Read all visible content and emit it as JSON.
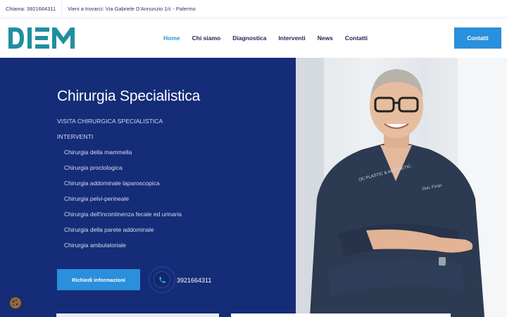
{
  "topbar": {
    "phone": "Chiama: 3921664311",
    "address": "Vieni a trovarci: Via Gabriele D'Annunzio 1/c - Palermo"
  },
  "brand": {
    "logo_text": "DIEM",
    "logo_color": "#1f8fa0"
  },
  "nav": {
    "items": [
      {
        "label": "Home",
        "active": true
      },
      {
        "label": "Chi siamo"
      },
      {
        "label": "Diagnostica"
      },
      {
        "label": "Interventi"
      },
      {
        "label": "News"
      },
      {
        "label": "Contatti"
      }
    ],
    "cta_label": "Contatti"
  },
  "hero": {
    "title": "Chirurgia Specialistica",
    "visit_label": "VISITA CHIRURGICA SPECIALISTICA",
    "interventions_label": "INTERVENTI",
    "interventions": [
      "Chirurgia della mammella",
      "Chirurgia proctologica",
      "Chirurgia addominale laparoscopica",
      "Chirurgia pelvi-perineale",
      "Chirurgia dell'incontinenza fecale ed urinaria",
      "Chirurgia della parete addominale",
      "Chirurgia ambulatoriale"
    ],
    "cta_label": "Richiedi informazioni",
    "phone": "3921664311"
  },
  "colors": {
    "panel": "#152c78",
    "accent": "#2a8fdc",
    "active_link": "#2a98d8"
  },
  "icons": {
    "phone": "phone-icon",
    "cookie": "cookie-icon"
  }
}
